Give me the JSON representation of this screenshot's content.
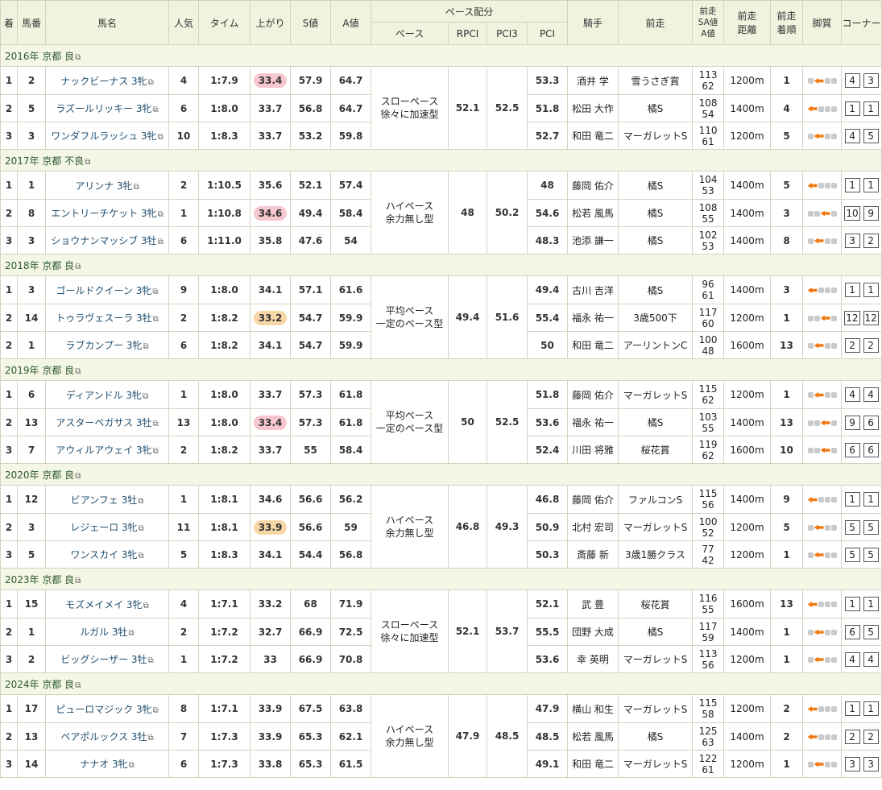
{
  "headers": {
    "rank": "着",
    "gate": "馬番",
    "horse": "馬名",
    "pop": "人気",
    "time": "タイム",
    "last3f": "上がり",
    "s_val": "S値",
    "a_val": "A値",
    "pace_group": "ペース配分",
    "pace": "ペース",
    "rpci": "RPCI",
    "pci3": "PCI3",
    "pci": "PCI",
    "jockey": "騎手",
    "prev_race": "前走",
    "prev_sa_1": "前走",
    "prev_sa_2": "SA値",
    "prev_sa_3": "A値",
    "prev_dist_1": "前走",
    "prev_dist_2": "距離",
    "prev_rank_1": "前走",
    "prev_rank_2": "着順",
    "style": "脚質",
    "corner": "コーナー"
  },
  "icons": {
    "external": "external-link-icon",
    "style": "running-style-arrow-icon"
  },
  "colors": {
    "header_bg": "#f1f3df",
    "section_bg": "#f4f6e6",
    "highlight_pink": "#f6c7cf",
    "highlight_orange": "#f8d7a6",
    "style_active": "#f07a14"
  },
  "sections": [
    {
      "label": "2016年 京都 良",
      "pace": [
        "スローペース",
        "徐々に加速型"
      ],
      "rpci": "52.1",
      "pci3": "52.5",
      "rows": [
        {
          "rank": "1",
          "gate": "2",
          "name": "ナックビーナス 3牝",
          "pop": "4",
          "time": "1:7.9",
          "last3f": "33.4",
          "hl": "pink",
          "s": "57.9",
          "a": "64.7",
          "pci": "53.3",
          "jockey": "酒井 学",
          "prev": "雪うさぎ賞",
          "sa1": "113",
          "sa2": "62",
          "dist": "1200m",
          "prank": "1",
          "style": 2,
          "corner": [
            "4",
            "3"
          ]
        },
        {
          "rank": "2",
          "gate": "5",
          "name": "ラズールリッキー 3牝",
          "pop": "6",
          "time": "1:8.0",
          "last3f": "33.7",
          "hl": "",
          "s": "56.8",
          "a": "64.7",
          "pci": "51.8",
          "jockey": "松田 大作",
          "prev": "橘S",
          "sa1": "108",
          "sa2": "54",
          "dist": "1400m",
          "prank": "4",
          "style": 1,
          "corner": [
            "1",
            "1"
          ]
        },
        {
          "rank": "3",
          "gate": "3",
          "name": "ワンダフルラッシュ 3牝",
          "pop": "10",
          "time": "1:8.3",
          "last3f": "33.7",
          "hl": "",
          "s": "53.2",
          "a": "59.8",
          "pci": "52.7",
          "jockey": "和田 竜二",
          "prev": "マーガレットS",
          "sa1": "110",
          "sa2": "61",
          "dist": "1200m",
          "prank": "5",
          "style": 2,
          "corner": [
            "4",
            "5"
          ]
        }
      ]
    },
    {
      "label": "2017年 京都 不良",
      "pace": [
        "ハイペース",
        "余力無し型"
      ],
      "rpci": "48",
      "pci3": "50.2",
      "rows": [
        {
          "rank": "1",
          "gate": "1",
          "name": "アリンナ 3牝",
          "pop": "2",
          "time": "1:10.5",
          "last3f": "35.6",
          "hl": "",
          "s": "52.1",
          "a": "57.4",
          "pci": "48",
          "jockey": "藤岡 佑介",
          "prev": "橘S",
          "sa1": "104",
          "sa2": "53",
          "dist": "1400m",
          "prank": "5",
          "style": 1,
          "corner": [
            "1",
            "1"
          ]
        },
        {
          "rank": "2",
          "gate": "8",
          "name": "エントリーチケット 3牝",
          "pop": "1",
          "time": "1:10.8",
          "last3f": "34.6",
          "hl": "pink",
          "s": "49.4",
          "a": "58.4",
          "pci": "54.6",
          "jockey": "松若 風馬",
          "prev": "橘S",
          "sa1": "108",
          "sa2": "55",
          "dist": "1400m",
          "prank": "3",
          "style": 3,
          "corner": [
            "10",
            "9"
          ]
        },
        {
          "rank": "3",
          "gate": "3",
          "name": "ショウナンマッシブ 3牡",
          "pop": "6",
          "time": "1:11.0",
          "last3f": "35.8",
          "hl": "",
          "s": "47.6",
          "a": "54",
          "pci": "48.3",
          "jockey": "池添 謙一",
          "prev": "橘S",
          "sa1": "102",
          "sa2": "53",
          "dist": "1400m",
          "prank": "8",
          "style": 2,
          "corner": [
            "3",
            "2"
          ]
        }
      ]
    },
    {
      "label": "2018年 京都 良",
      "pace": [
        "平均ペース",
        "一定のペース型"
      ],
      "rpci": "49.4",
      "pci3": "51.6",
      "rows": [
        {
          "rank": "1",
          "gate": "3",
          "name": "ゴールドクイーン 3牝",
          "pop": "9",
          "time": "1:8.0",
          "last3f": "34.1",
          "hl": "",
          "s": "57.1",
          "a": "61.6",
          "pci": "49.4",
          "jockey": "古川 吉洋",
          "prev": "橘S",
          "sa1": "96",
          "sa2": "61",
          "dist": "1400m",
          "prank": "3",
          "style": 1,
          "corner": [
            "1",
            "1"
          ]
        },
        {
          "rank": "2",
          "gate": "14",
          "name": "トゥラヴェスーラ 3牡",
          "pop": "2",
          "time": "1:8.2",
          "last3f": "33.2",
          "hl": "orange",
          "s": "54.7",
          "a": "59.9",
          "pci": "55.4",
          "jockey": "福永 祐一",
          "prev": "3歳500下",
          "sa1": "117",
          "sa2": "60",
          "dist": "1200m",
          "prank": "1",
          "style": 3,
          "corner": [
            "12",
            "12"
          ]
        },
        {
          "rank": "2",
          "gate": "1",
          "name": "ラブカンプー 3牝",
          "pop": "6",
          "time": "1:8.2",
          "last3f": "34.1",
          "hl": "",
          "s": "54.7",
          "a": "59.9",
          "pci": "50",
          "jockey": "和田 竜二",
          "prev": "アーリントンC",
          "sa1": "100",
          "sa2": "48",
          "dist": "1600m",
          "prank": "13",
          "style": 2,
          "corner": [
            "2",
            "2"
          ]
        }
      ]
    },
    {
      "label": "2019年 京都 良",
      "pace": [
        "平均ペース",
        "一定のペース型"
      ],
      "rpci": "50",
      "pci3": "52.5",
      "rows": [
        {
          "rank": "1",
          "gate": "6",
          "name": "ディアンドル 3牝",
          "pop": "1",
          "time": "1:8.0",
          "last3f": "33.7",
          "hl": "",
          "s": "57.3",
          "a": "61.8",
          "pci": "51.8",
          "jockey": "藤岡 佑介",
          "prev": "マーガレットS",
          "sa1": "115",
          "sa2": "62",
          "dist": "1200m",
          "prank": "1",
          "style": 2,
          "corner": [
            "4",
            "4"
          ]
        },
        {
          "rank": "2",
          "gate": "13",
          "name": "アスターペガサス 3牡",
          "pop": "13",
          "time": "1:8.0",
          "last3f": "33.4",
          "hl": "pink",
          "s": "57.3",
          "a": "61.8",
          "pci": "53.6",
          "jockey": "福永 祐一",
          "prev": "橘S",
          "sa1": "103",
          "sa2": "55",
          "dist": "1400m",
          "prank": "13",
          "style": 3,
          "corner": [
            "9",
            "6"
          ]
        },
        {
          "rank": "3",
          "gate": "7",
          "name": "アウィルアウェイ 3牝",
          "pop": "2",
          "time": "1:8.2",
          "last3f": "33.7",
          "hl": "",
          "s": "55",
          "a": "58.4",
          "pci": "52.4",
          "jockey": "川田 将雅",
          "prev": "桜花賞",
          "sa1": "119",
          "sa2": "62",
          "dist": "1600m",
          "prank": "10",
          "style": 3,
          "corner": [
            "6",
            "6"
          ]
        }
      ]
    },
    {
      "label": "2020年 京都 良",
      "pace": [
        "ハイペース",
        "余力無し型"
      ],
      "rpci": "46.8",
      "pci3": "49.3",
      "rows": [
        {
          "rank": "1",
          "gate": "12",
          "name": "ビアンフェ 3牡",
          "pop": "1",
          "time": "1:8.1",
          "last3f": "34.6",
          "hl": "",
          "s": "56.6",
          "a": "56.2",
          "pci": "46.8",
          "jockey": "藤岡 佑介",
          "prev": "ファルコンS",
          "sa1": "115",
          "sa2": "56",
          "dist": "1400m",
          "prank": "9",
          "style": 1,
          "corner": [
            "1",
            "1"
          ]
        },
        {
          "rank": "2",
          "gate": "3",
          "name": "レジェーロ 3牝",
          "pop": "11",
          "time": "1:8.1",
          "last3f": "33.9",
          "hl": "orange",
          "s": "56.6",
          "a": "59",
          "pci": "50.9",
          "jockey": "北村 宏司",
          "prev": "マーガレットS",
          "sa1": "100",
          "sa2": "52",
          "dist": "1200m",
          "prank": "5",
          "style": 2,
          "corner": [
            "5",
            "5"
          ]
        },
        {
          "rank": "3",
          "gate": "5",
          "name": "ワンスカイ 3牝",
          "pop": "5",
          "time": "1:8.3",
          "last3f": "34.1",
          "hl": "",
          "s": "54.4",
          "a": "56.8",
          "pci": "50.3",
          "jockey": "斎藤 新",
          "prev": "3歳1勝クラス",
          "sa1": "77",
          "sa2": "42",
          "dist": "1200m",
          "prank": "1",
          "style": 2,
          "corner": [
            "5",
            "5"
          ]
        }
      ]
    },
    {
      "label": "2023年 京都 良",
      "pace": [
        "スローペース",
        "徐々に加速型"
      ],
      "rpci": "52.1",
      "pci3": "53.7",
      "rows": [
        {
          "rank": "1",
          "gate": "15",
          "name": "モズメイメイ 3牝",
          "pop": "4",
          "time": "1:7.1",
          "last3f": "33.2",
          "hl": "",
          "s": "68",
          "a": "71.9",
          "pci": "52.1",
          "jockey": "武 豊",
          "prev": "桜花賞",
          "sa1": "116",
          "sa2": "55",
          "dist": "1600m",
          "prank": "13",
          "style": 1,
          "corner": [
            "1",
            "1"
          ]
        },
        {
          "rank": "2",
          "gate": "1",
          "name": "ルガル 3牡",
          "pop": "2",
          "time": "1:7.2",
          "last3f": "32.7",
          "hl": "",
          "s": "66.9",
          "a": "72.5",
          "pci": "55.5",
          "jockey": "団野 大成",
          "prev": "橘S",
          "sa1": "117",
          "sa2": "59",
          "dist": "1400m",
          "prank": "1",
          "style": 2,
          "corner": [
            "6",
            "5"
          ]
        },
        {
          "rank": "3",
          "gate": "2",
          "name": "ビッグシーザー 3牡",
          "pop": "1",
          "time": "1:7.2",
          "last3f": "33",
          "hl": "",
          "s": "66.9",
          "a": "70.8",
          "pci": "53.6",
          "jockey": "幸 英明",
          "prev": "マーガレットS",
          "sa1": "113",
          "sa2": "56",
          "dist": "1200m",
          "prank": "1",
          "style": 2,
          "corner": [
            "4",
            "4"
          ]
        }
      ]
    },
    {
      "label": "2024年 京都 良",
      "pace": [
        "ハイペース",
        "余力無し型"
      ],
      "rpci": "47.9",
      "pci3": "48.5",
      "rows": [
        {
          "rank": "1",
          "gate": "17",
          "name": "ピューロマジック 3牝",
          "pop": "8",
          "time": "1:7.1",
          "last3f": "33.9",
          "hl": "",
          "s": "67.5",
          "a": "63.8",
          "pci": "47.9",
          "jockey": "横山 和生",
          "prev": "マーガレットS",
          "sa1": "115",
          "sa2": "58",
          "dist": "1200m",
          "prank": "2",
          "style": 1,
          "corner": [
            "1",
            "1"
          ]
        },
        {
          "rank": "2",
          "gate": "13",
          "name": "ペアポルックス 3牡",
          "pop": "7",
          "time": "1:7.3",
          "last3f": "33.9",
          "hl": "",
          "s": "65.3",
          "a": "62.1",
          "pci": "48.5",
          "jockey": "松若 風馬",
          "prev": "橘S",
          "sa1": "125",
          "sa2": "63",
          "dist": "1400m",
          "prank": "2",
          "style": 1,
          "corner": [
            "2",
            "2"
          ]
        },
        {
          "rank": "3",
          "gate": "14",
          "name": "ナナオ 3牝",
          "pop": "6",
          "time": "1:7.3",
          "last3f": "33.8",
          "hl": "",
          "s": "65.3",
          "a": "61.5",
          "pci": "49.1",
          "jockey": "和田 竜二",
          "prev": "マーガレットS",
          "sa1": "122",
          "sa2": "61",
          "dist": "1200m",
          "prank": "1",
          "style": 2,
          "corner": [
            "3",
            "3"
          ]
        }
      ]
    }
  ]
}
